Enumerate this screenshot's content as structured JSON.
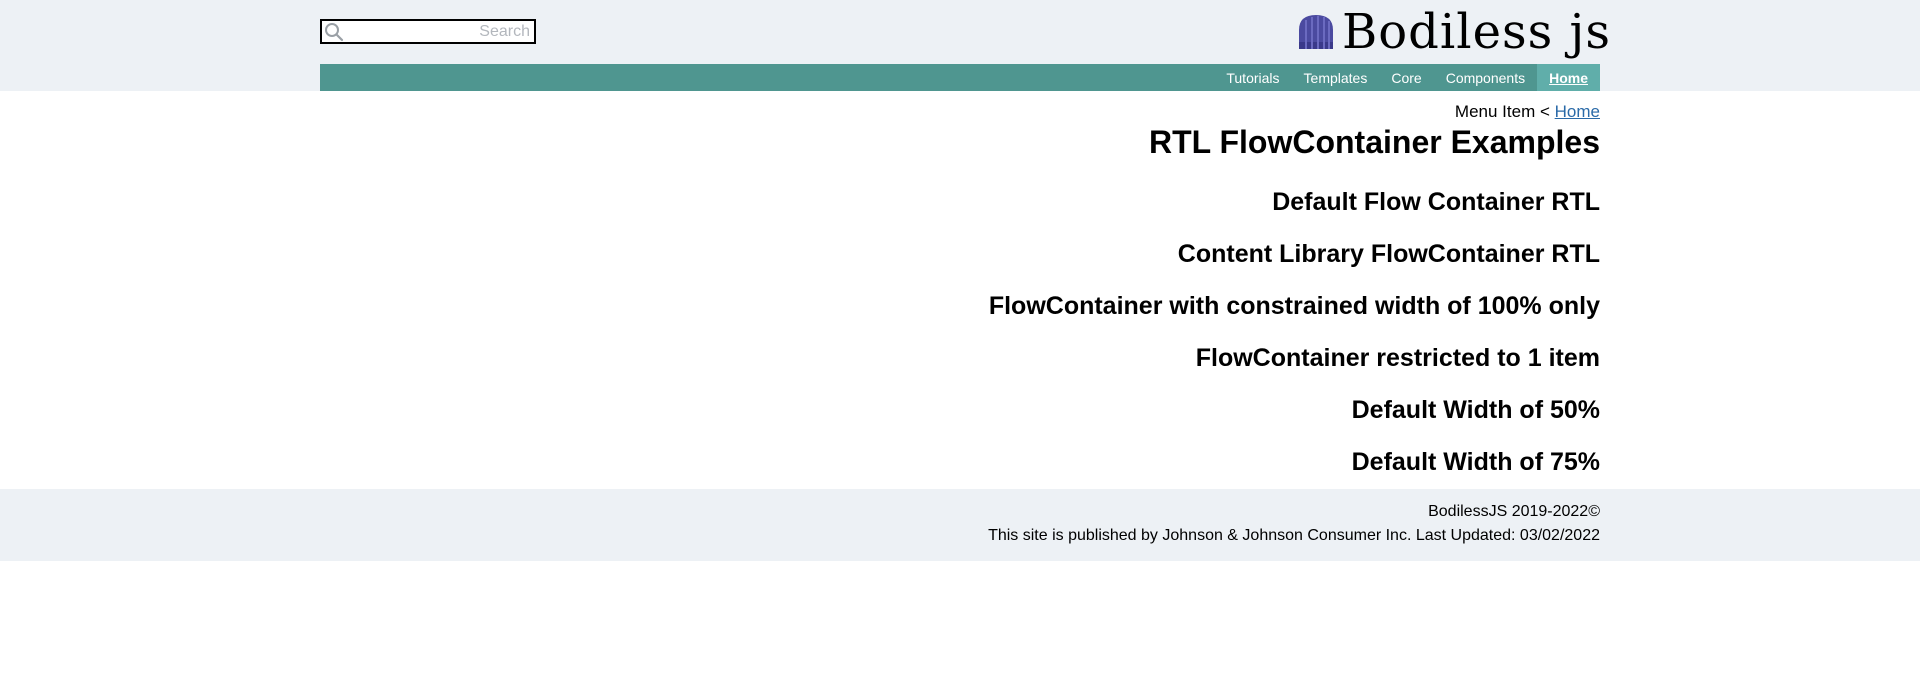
{
  "search": {
    "placeholder": "Search",
    "value": ""
  },
  "logo": {
    "text": "Bodiless js",
    "icon": "beanie-logo-icon",
    "icon_color": "#4b4aa0"
  },
  "nav": {
    "items": [
      {
        "label": "Tutorials"
      },
      {
        "label": "Templates"
      },
      {
        "label": "Core"
      },
      {
        "label": "Components"
      },
      {
        "label": "Home",
        "active": true
      }
    ],
    "bar_color": "#4f9690",
    "active_color": "#60aeaa"
  },
  "breadcrumb": {
    "current": "Menu Item",
    "separator": "<",
    "home_link": "Home"
  },
  "page": {
    "title": "RTL FlowContainer Examples",
    "sections": [
      "Default Flow Container RTL",
      "Content Library FlowContainer RTL",
      "FlowContainer with constrained width of 100% only",
      "FlowContainer restricted to 1 item",
      "Default Width of 50%",
      "Default Width of 75%"
    ]
  },
  "footer": {
    "copyright": "BodilessJS 2019-2022©",
    "publisher": "This site is published by Johnson & Johnson Consumer Inc. Last Updated: 03/02/2022"
  }
}
